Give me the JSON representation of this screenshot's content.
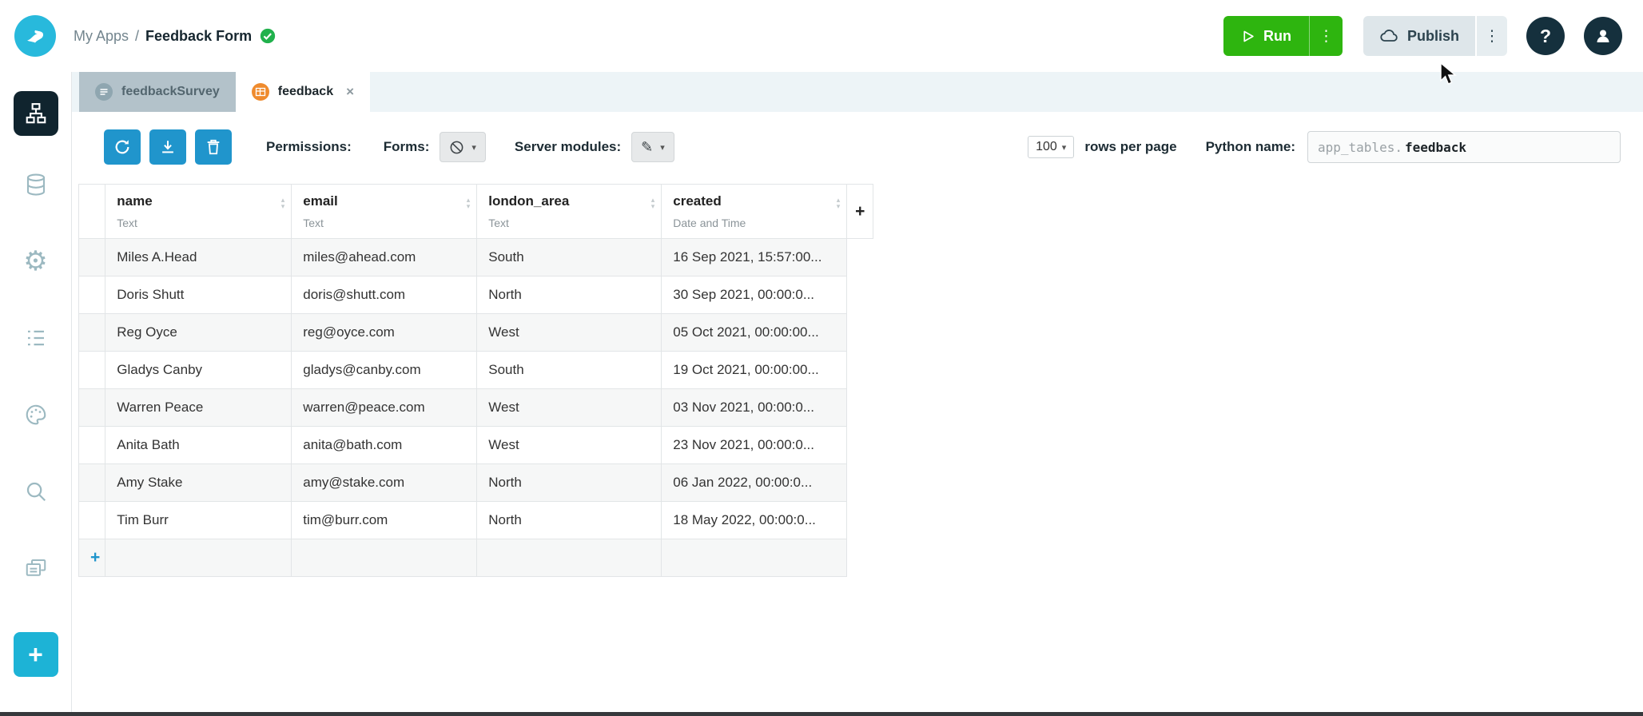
{
  "header": {
    "breadcrumb": {
      "root": "My Apps",
      "separator": "/",
      "current": "Feedback Form"
    },
    "run_label": "Run",
    "publish_label": "Publish"
  },
  "tabs": {
    "items": [
      {
        "label": "feedbackSurvey",
        "active": false
      },
      {
        "label": "feedback",
        "active": true
      }
    ],
    "close_label": "×"
  },
  "toolbar": {
    "permissions_label": "Permissions:",
    "forms_label": "Forms:",
    "server_modules_label": "Server modules:",
    "rows_per_page_value": "100",
    "rows_per_page_label": "rows per page",
    "python_name_label": "Python name:",
    "python_name_prefix": "app_tables.",
    "python_name_value": "feedback"
  },
  "table": {
    "add_column_label": "+",
    "add_row_label": "+",
    "columns": [
      {
        "name": "name",
        "type": "Text"
      },
      {
        "name": "email",
        "type": "Text"
      },
      {
        "name": "london_area",
        "type": "Text"
      },
      {
        "name": "created",
        "type": "Date and Time"
      }
    ],
    "rows": [
      {
        "name": "Miles A.Head",
        "email": "miles@ahead.com",
        "london_area": "South",
        "created": "16 Sep 2021, 15:57:00..."
      },
      {
        "name": "Doris Shutt",
        "email": "doris@shutt.com",
        "london_area": "North",
        "created": "30 Sep 2021, 00:00:0..."
      },
      {
        "name": "Reg Oyce",
        "email": "reg@oyce.com",
        "london_area": "West",
        "created": "05 Oct 2021, 00:00:00..."
      },
      {
        "name": "Gladys Canby",
        "email": "gladys@canby.com",
        "london_area": "South",
        "created": "19 Oct 2021, 00:00:00..."
      },
      {
        "name": "Warren Peace",
        "email": "warren@peace.com",
        "london_area": "West",
        "created": "03 Nov 2021, 00:00:0..."
      },
      {
        "name": "Anita Bath",
        "email": "anita@bath.com",
        "london_area": "West",
        "created": "23 Nov 2021, 00:00:0..."
      },
      {
        "name": "Amy Stake",
        "email": "amy@stake.com",
        "london_area": "North",
        "created": "06 Jan 2022, 00:00:0..."
      },
      {
        "name": "Tim Burr",
        "email": "tim@burr.com",
        "london_area": "North",
        "created": "18 May 2022, 00:00:0..."
      }
    ]
  },
  "colors": {
    "accent_teal": "#1db3d6",
    "run_green": "#2eb50f",
    "toolbar_blue": "#2095cc",
    "tab_orange": "#ef8b2e",
    "dark_circle": "#15303d",
    "check_green": "#21b14c"
  }
}
